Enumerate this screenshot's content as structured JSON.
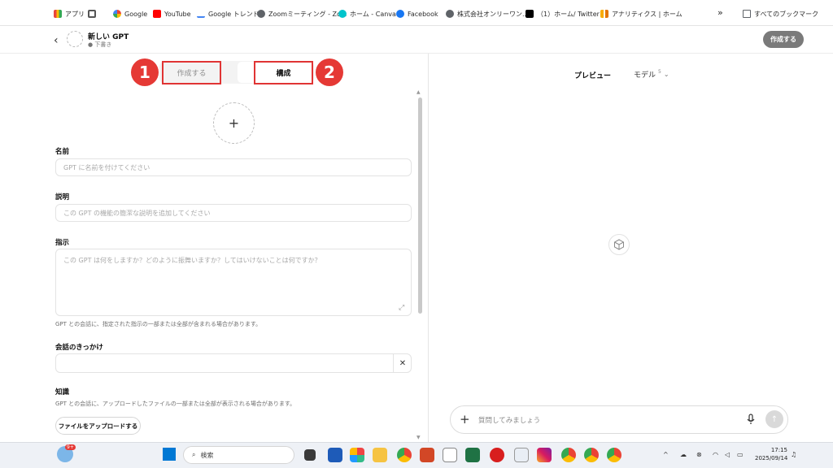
{
  "bookmarks": [
    {
      "label": "アプリ",
      "icon": "apps-grid-icon",
      "color": "#e8453c"
    },
    {
      "label": "",
      "icon": "grid-icon",
      "color": "#555555"
    },
    {
      "label": "Google",
      "icon": "google-icon",
      "color": "#4285f4"
    },
    {
      "label": "YouTube",
      "icon": "youtube-icon",
      "color": "#ff0000"
    },
    {
      "label": "Google トレンド",
      "icon": "trends-icon",
      "color": "#4285f4"
    },
    {
      "label": "Zoomミーティング - Zo...",
      "icon": "globe-icon",
      "color": "#5f6368"
    },
    {
      "label": "ホーム - Canva",
      "icon": "canva-icon",
      "color": "#00c4cc"
    },
    {
      "label": "Facebook",
      "icon": "facebook-icon",
      "color": "#1877f2"
    },
    {
      "label": "株式会社オンリーワン...",
      "icon": "globe-icon",
      "color": "#5f6368"
    },
    {
      "label": "（1）ホーム/ Twitter",
      "icon": "x-icon",
      "color": "#000000"
    },
    {
      "label": "アナリティクス | ホーム",
      "icon": "analytics-icon",
      "color": "#f9ab00"
    },
    {
      "label": "すべてのブックマーク",
      "icon": "folder-icon",
      "color": "#5f6368"
    }
  ],
  "bookmarks_more": "»",
  "header": {
    "back": "‹",
    "title": "新しい GPT",
    "subtitle": "● 下書き",
    "create_button": "作成する"
  },
  "tabs": {
    "create": "作成する",
    "configure": "構成"
  },
  "callouts": {
    "one": "1",
    "two": "2",
    "color": "#e53935"
  },
  "image_picker": "+",
  "form": {
    "name_label": "名前",
    "name_placeholder": "GPT に名前を付けてください",
    "description_label": "説明",
    "description_placeholder": "この GPT の機能の簡潔な説明を追加してください",
    "instructions_label": "指示",
    "instructions_placeholder": "この GPT は何をしますか？どのように振舞いますか？してはいけないことは何ですか？",
    "instructions_hint": "GPT との会話に、指定された指示の一部または全部が含まれる場合があります。",
    "starters_label": "会話のきっかけ",
    "starters_value": "",
    "starters_clear": "✕",
    "knowledge_label": "知識",
    "knowledge_hint": "GPT との会話に、アップロードしたファイルの一部または全部が表示される場合があります。",
    "upload_button": "ファイルをアップロードする"
  },
  "preview": {
    "title": "プレビュー",
    "model_label": "モデル",
    "model_version": "5",
    "model_chevron": "⌄",
    "chat_plus": "+",
    "chat_placeholder": "質問してみましょう",
    "send": "↑"
  },
  "taskbar": {
    "search_label": "検索",
    "time": "17:15",
    "date": "2025/09/14",
    "weather_badge": "9+",
    "tray_up": "^"
  },
  "colors": {
    "accent_red": "#e03434",
    "top_button": "#7a7a7a"
  }
}
